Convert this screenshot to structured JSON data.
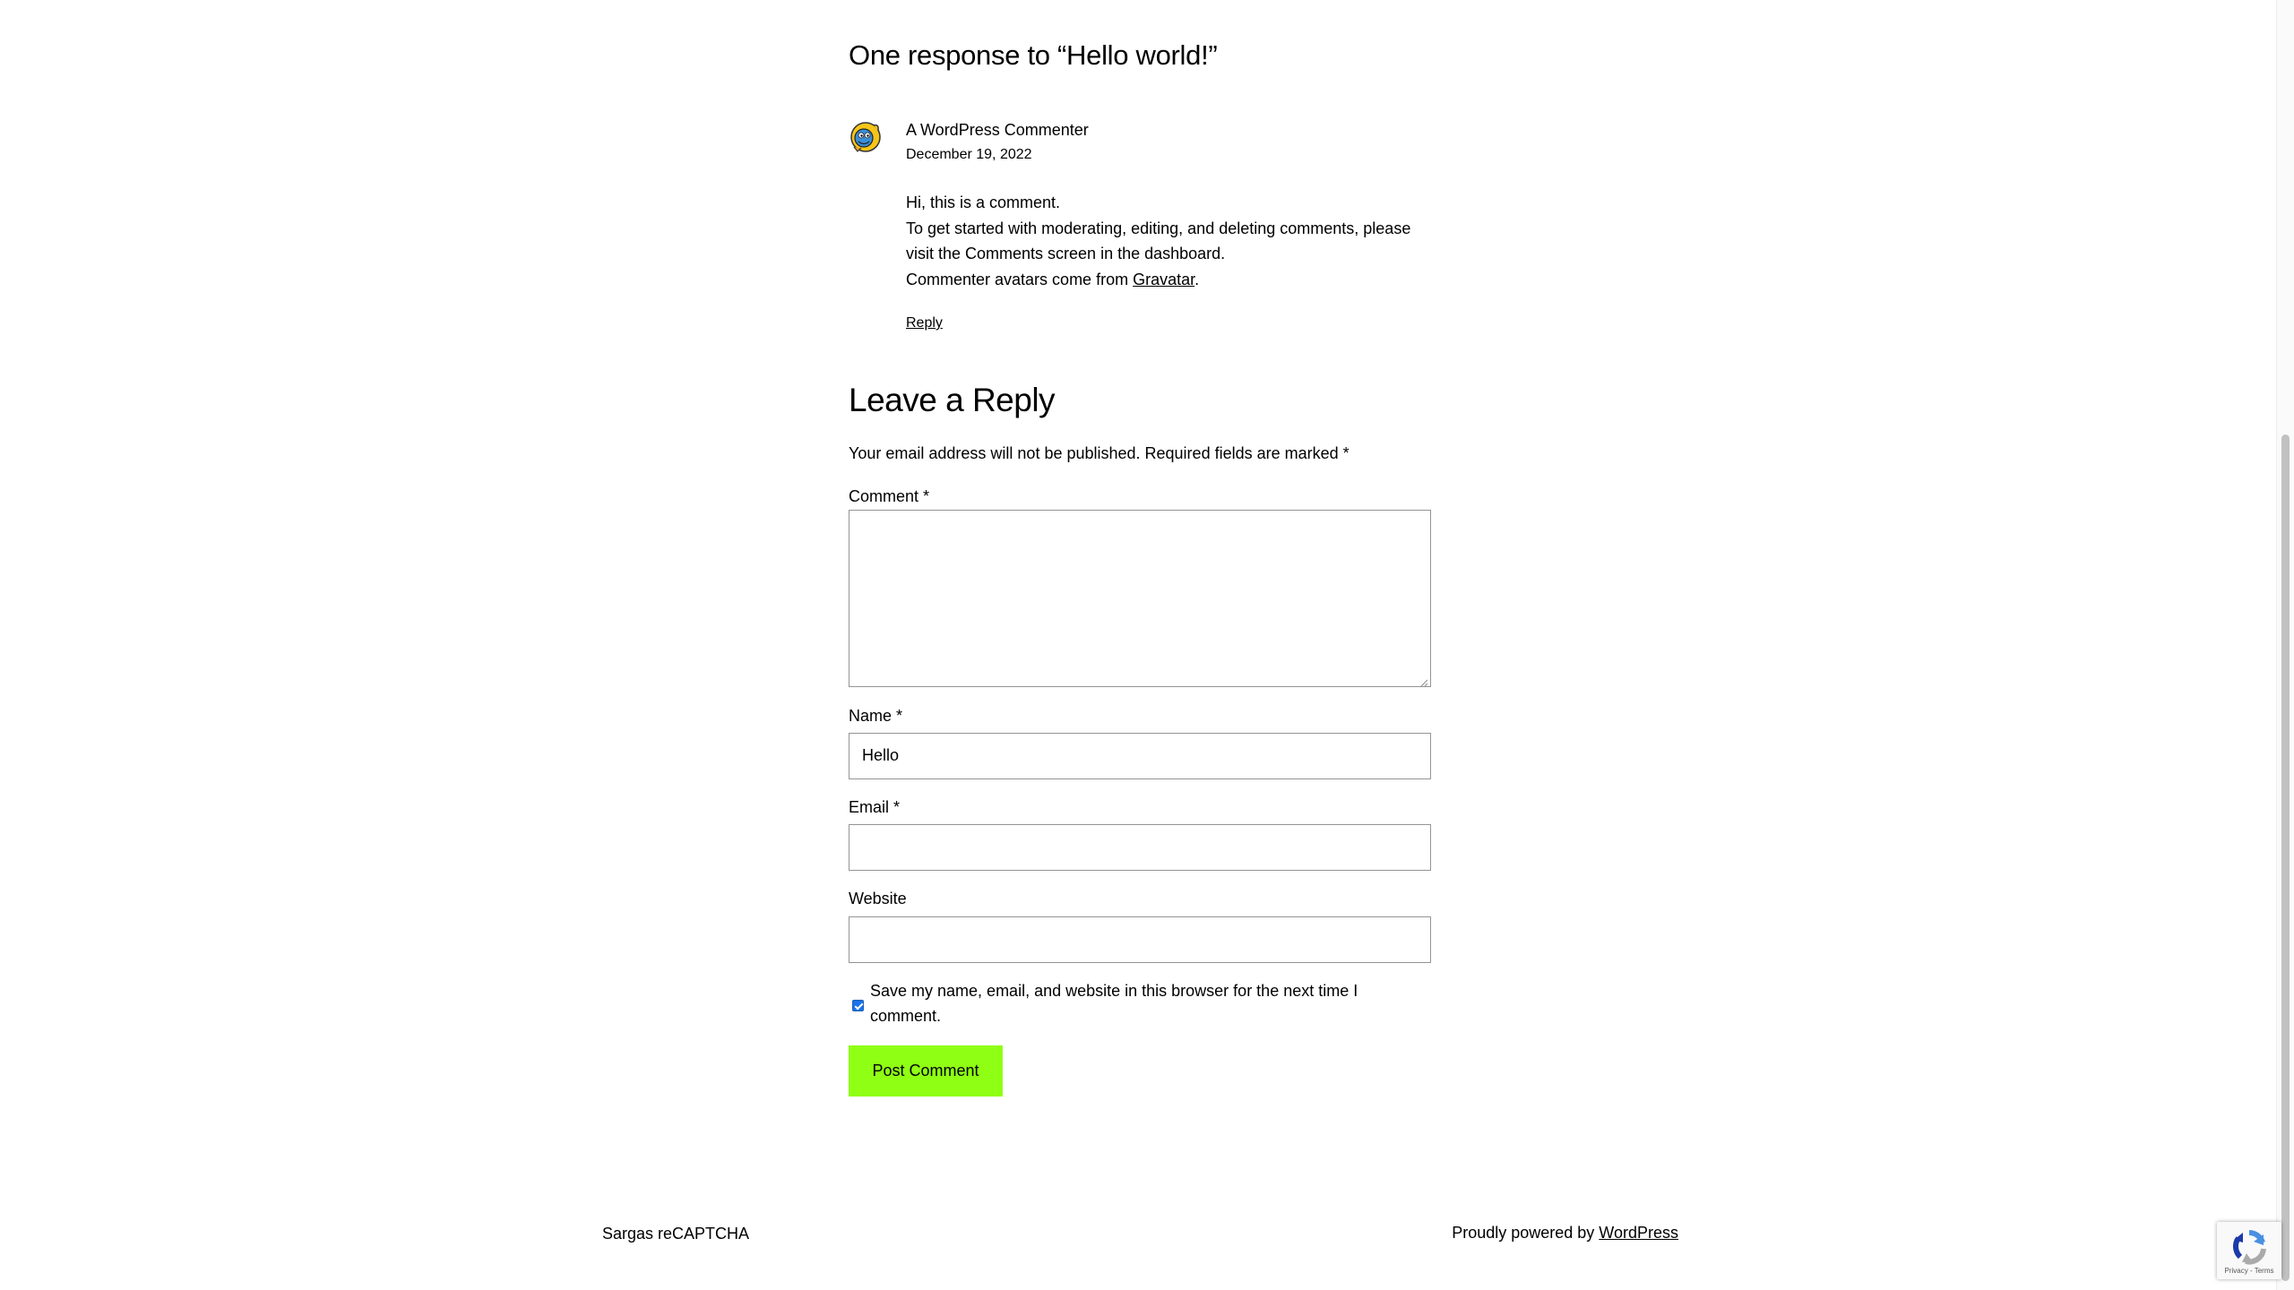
{
  "comments": {
    "title": "One response to “Hello world!”",
    "items": [
      {
        "author": "A WordPress Commenter",
        "date": "December 19, 2022",
        "avatar_icon": "wapuu-avatar-icon",
        "lines": [
          "Hi, this is a comment.",
          "To get started with moderating, editing, and deleting comments, please visit the Comments screen in the dashboard."
        ],
        "avatar_line_prefix": "Commenter avatars come from ",
        "avatar_link": "Gravatar",
        "avatar_line_suffix": ".",
        "reply_label": "Reply"
      }
    ]
  },
  "reply_form": {
    "title": "Leave a Reply",
    "notes": "Your email address will not be published. Required fields are marked *",
    "comment_label": "Comment *",
    "comment_value": "",
    "name_label": "Name *",
    "name_value": "Hello",
    "email_label": "Email *",
    "email_value": "",
    "website_label": "Website",
    "website_value": "",
    "cookies_checked": true,
    "cookies_label": "Save my name, email, and website in this browser for the next time I comment.",
    "submit_label": "Post Comment",
    "submit_color": "#8fff14"
  },
  "footer": {
    "site_title": "Sargas reCAPTCHA",
    "credit_prefix": "Proudly powered by ",
    "credit_link": "WordPress"
  },
  "recaptcha_badge": {
    "icon": "recaptcha-logo-icon",
    "terms": "Privacy - Terms"
  }
}
